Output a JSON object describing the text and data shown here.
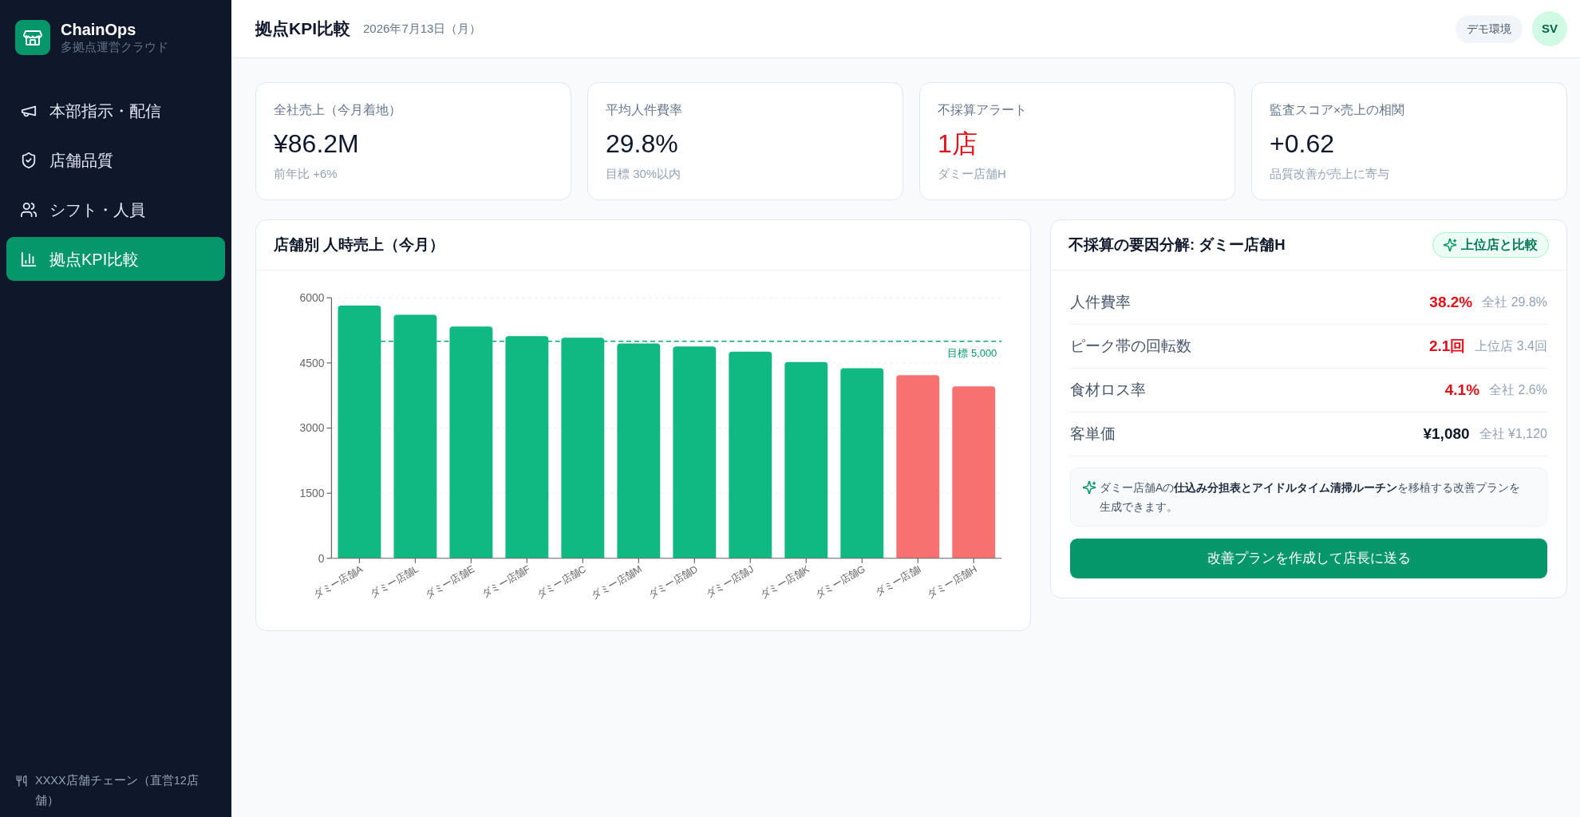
{
  "sidebar": {
    "brand": {
      "name": "ChainOps",
      "tagline": "多拠点運営クラウド"
    },
    "items": [
      {
        "label": "本部指示・配信",
        "selected": false
      },
      {
        "label": "店舗品質",
        "selected": false
      },
      {
        "label": "シフト・人員",
        "selected": false
      },
      {
        "label": "拠点KPI比較",
        "selected": true
      }
    ],
    "footer": "XXXX店舗チェーン（直営12店舗）"
  },
  "header": {
    "title": "拠点KPI比較",
    "date": "2026年7月13日（月）",
    "environment": "デモ環境",
    "avatar": "SV"
  },
  "kpis": [
    {
      "label": "全社売上（今月着地）",
      "value": "¥86.2M",
      "note": "前年比 +6%",
      "alert": false
    },
    {
      "label": "平均人件費率",
      "value": "29.8%",
      "note": "目標 30%以内",
      "alert": false
    },
    {
      "label": "不採算アラート",
      "value": "1店",
      "note": "ダミー店舗H",
      "alert": true
    },
    {
      "label": "監査スコア×売上の相関",
      "value": "+0.62",
      "note": "品質改善が売上に寄与",
      "alert": false
    }
  ],
  "chart_panel": {
    "title": "店舗別 人時売上（今月）",
    "chart_data": {
      "type": "bar",
      "categories": [
        "ダミー店舗A",
        "ダミー店舗L",
        "ダミー店舗E",
        "ダミー店舗F",
        "ダミー店舗C",
        "ダミー店舗M",
        "ダミー店舗D",
        "ダミー店舗J",
        "ダミー店舗K",
        "ダミー店舗G",
        "ダミー店舗I",
        "ダミー店舗H"
      ],
      "series": [
        {
          "color": "#10b981",
          "values": [
            5820,
            5610,
            5340,
            5120,
            5080,
            4950,
            4880,
            4760,
            4520,
            4380,
            null,
            null
          ]
        },
        {
          "color": "#f87171",
          "values": [
            null,
            null,
            null,
            null,
            null,
            null,
            null,
            null,
            null,
            null,
            4220,
            3960
          ]
        }
      ],
      "stacked": true,
      "grid": true,
      "ylim": [
        0,
        6000
      ],
      "yticks": [
        0,
        1500,
        3000,
        4500,
        6000
      ],
      "ref_lines": [
        {
          "axis": "y",
          "value": 5000,
          "label": "目標 5,000",
          "color": "#10a37a"
        }
      ]
    }
  },
  "breakdown": {
    "title": "不採算の要因分解: ダミー店舗H",
    "action": "上位店と比較",
    "rows": [
      {
        "label": "人件費率",
        "value": "38.2%",
        "compare": "全社 29.8%",
        "alert": true
      },
      {
        "label": "ピーク帯の回転数",
        "value": "2.1回",
        "compare": "上位店 3.4回",
        "alert": true
      },
      {
        "label": "食材ロス率",
        "value": "4.1%",
        "compare": "全社 2.6%",
        "alert": true
      },
      {
        "label": "客単価",
        "value": "¥1,080",
        "compare": "全社 ¥1,120",
        "alert": false
      }
    ],
    "note": "ダミー店舗Aの**仕込み分担表とアイドルタイム清掃ルーチン**を移植する改善プランを生成できます。",
    "button": "改善プランを作成して店長に送る"
  }
}
